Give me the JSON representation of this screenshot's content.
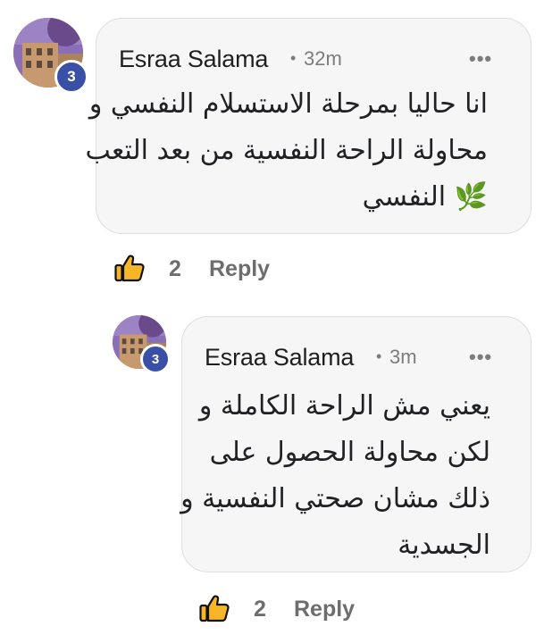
{
  "comments": [
    {
      "author": "Esraa Salama",
      "separator": "•",
      "time": "32m",
      "more": "•••",
      "badge": "3",
      "text_lines": [
        "انا حاليا بمرحلة الاستسلام النفسي و",
        "محاولة الراحة النفسية من بعد التعب",
        "النفسي"
      ],
      "emoji": "🌿",
      "like_count": "2",
      "reply_label": "Reply"
    },
    {
      "author": "Esraa Salama",
      "separator": "•",
      "time": "3m",
      "more": "•••",
      "badge": "3",
      "text_lines": [
        "يعني مش الراحة الكاملة و",
        "لكن محاولة الحصول على",
        "ذلك مشان صحتي النفسية و",
        "الجسدية"
      ],
      "like_count": "2",
      "reply_label": "Reply"
    }
  ],
  "icons": {
    "like": "thumbs-up-icon",
    "avatar_badge": "notification-badge",
    "more": "more-options-icon"
  },
  "colors": {
    "bubble_bg": "#f6f6f6",
    "badge": "#3a4fa6",
    "like_fill": "#f7b529",
    "muted_text": "#6d6d6d"
  }
}
